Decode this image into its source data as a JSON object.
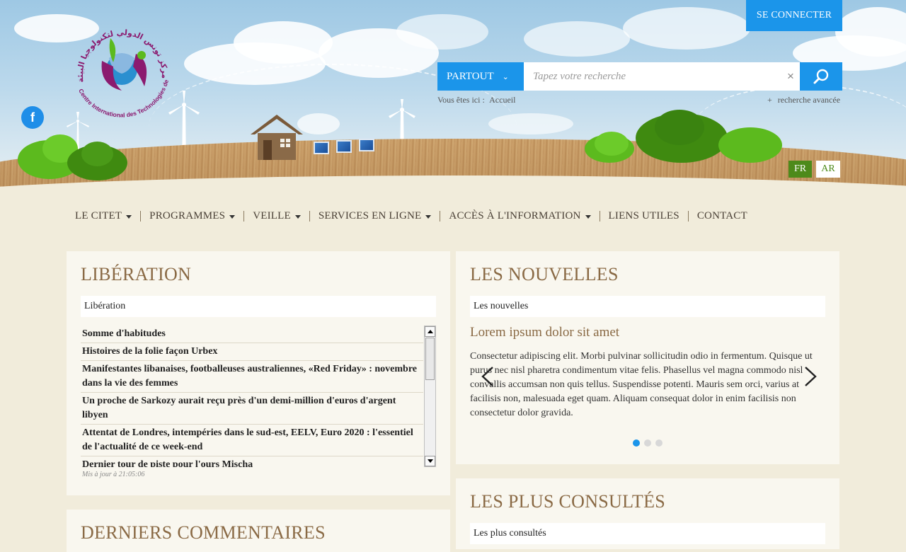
{
  "header": {
    "logo_text": "Centre International des Technologies de l'Environnement de Tunis",
    "connect_label": "SE CONNECTER",
    "search": {
      "scope_label": "PARTOUT",
      "placeholder": "Tapez votre recherche",
      "clear_label": "×"
    },
    "breadcrumb": {
      "prefix": "Vous êtes ici :",
      "home": "Accueil"
    },
    "advanced_search": "recherche avancée",
    "advanced_plus": "+",
    "languages": [
      "FR",
      "AR"
    ],
    "social": {
      "facebook": "f"
    }
  },
  "nav": {
    "items": [
      {
        "label": "LE CITET",
        "has_dropdown": true
      },
      {
        "label": "PROGRAMMES",
        "has_dropdown": true
      },
      {
        "label": "VEILLE",
        "has_dropdown": true
      },
      {
        "label": "SERVICES EN LIGNE",
        "has_dropdown": true
      },
      {
        "label": "ACCÈS À L'INFORMATION",
        "has_dropdown": true
      },
      {
        "label": "LIENS UTILES",
        "has_dropdown": false
      },
      {
        "label": "CONTACT",
        "has_dropdown": false
      }
    ]
  },
  "liberation": {
    "title": "LIBÉRATION",
    "subtitle": "Libération",
    "items": [
      "Somme d'habitudes",
      "Histoires de la folie façon Urbex",
      "Manifestantes libanaises, footballeuses australiennes, «Red Friday» : novembre dans la vie des femmes",
      "Un proche de Sarkozy aurait reçu près d'un demi-million d'euros d'argent libyen",
      "Attentat de Londres, intempéries dans le sud-est, EELV, Euro 2020 : l'essentiel de l'actualité de ce week-end",
      "Dernier tour de piste pour l'ours Mischa"
    ],
    "updated": "Mis à jour à 21:05:06"
  },
  "news": {
    "title": "LES NOUVELLES",
    "subtitle": "Les nouvelles",
    "slide_title": "Lorem ipsum dolor sit amet",
    "slide_body": "Consectetur adipiscing elit. Morbi pulvinar sollicitudin odio in fermentum. Quisque ut purus nec nisl pharetra condimentum vitae felis. Phasellus vel magna commodo nisl convallis accumsan non quis tellus. Suspendisse potenti. Mauris sem orci, varius at facilisis non, malesuada eget quam. Aliquam consequat dolor in enim facilisis non consectetur dolor gravida.",
    "slides_count": 3,
    "active_slide": 1
  },
  "most_viewed": {
    "title": "LES PLUS CONSULTÉS",
    "subtitle": "Les plus consultés"
  },
  "comments": {
    "title": "DERNIERS COMMENTAIRES"
  },
  "colors": {
    "accent_blue": "#1b95ea",
    "heading_brown": "#8a6a45",
    "lang_green": "#4d8a1a",
    "page_bg": "#f1ecdb",
    "card_bg": "#f9f7ef"
  },
  "icons": [
    "facebook-icon",
    "search-icon",
    "chevron-down-icon",
    "close-icon",
    "arrow-left-icon",
    "arrow-right-icon",
    "house-icon",
    "wind-turbine-icon",
    "solar-panel-icon"
  ]
}
